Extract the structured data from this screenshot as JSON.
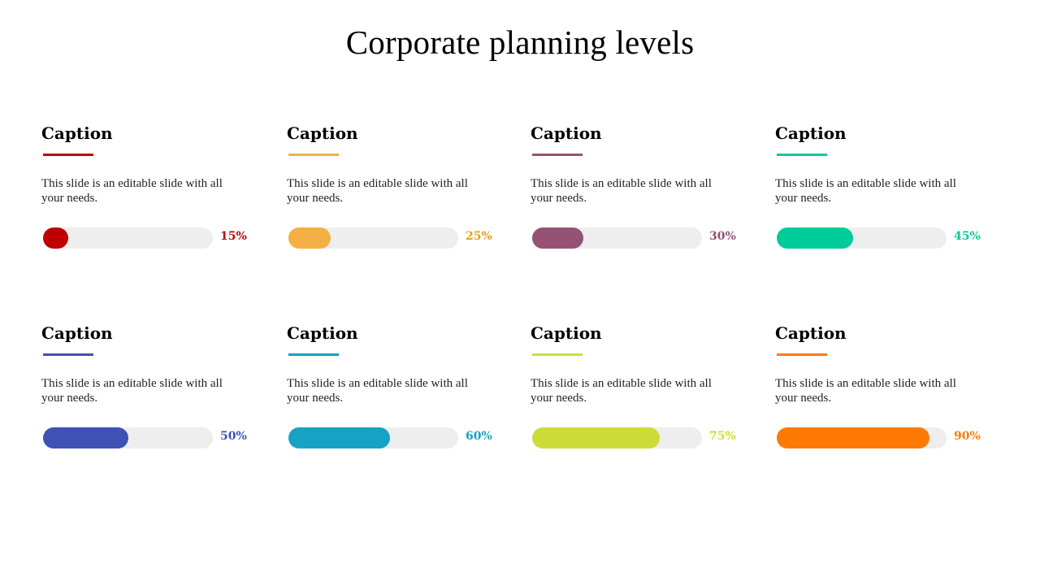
{
  "slide": {
    "title": "Corporate planning levels"
  },
  "cards": [
    {
      "caption": "Caption",
      "description": "This slide is an editable slide with all your needs.",
      "percent_label": "15%",
      "value": 15,
      "color": "#c00000"
    },
    {
      "caption": "Caption",
      "description": "This slide is an editable slide with all your needs.",
      "percent_label": "25%",
      "value": 25,
      "color": "#f4b042",
      "label_color": "#e0a020"
    },
    {
      "caption": "Caption",
      "description": "This slide is an editable slide with all your needs.",
      "percent_label": "30%",
      "value": 30,
      "color": "#955273"
    },
    {
      "caption": "Caption",
      "description": "This slide is an editable slide with all your needs.",
      "percent_label": "45%",
      "value": 45,
      "color": "#00cc99"
    },
    {
      "caption": "Caption",
      "description": "This slide is an editable slide with all your needs.",
      "percent_label": "50%",
      "value": 50,
      "color": "#3f51b5"
    },
    {
      "caption": "Caption",
      "description": "This slide is an editable slide with all your needs.",
      "percent_label": "60%",
      "value": 60,
      "color": "#16a2c4"
    },
    {
      "caption": "Caption",
      "description": "This slide is an editable slide with all your needs.",
      "percent_label": "75%",
      "value": 75,
      "color": "#cddc39"
    },
    {
      "caption": "Caption",
      "description": "This slide is an editable slide with all your needs.",
      "percent_label": "90%",
      "value": 90,
      "color": "#ff7a05"
    }
  ]
}
